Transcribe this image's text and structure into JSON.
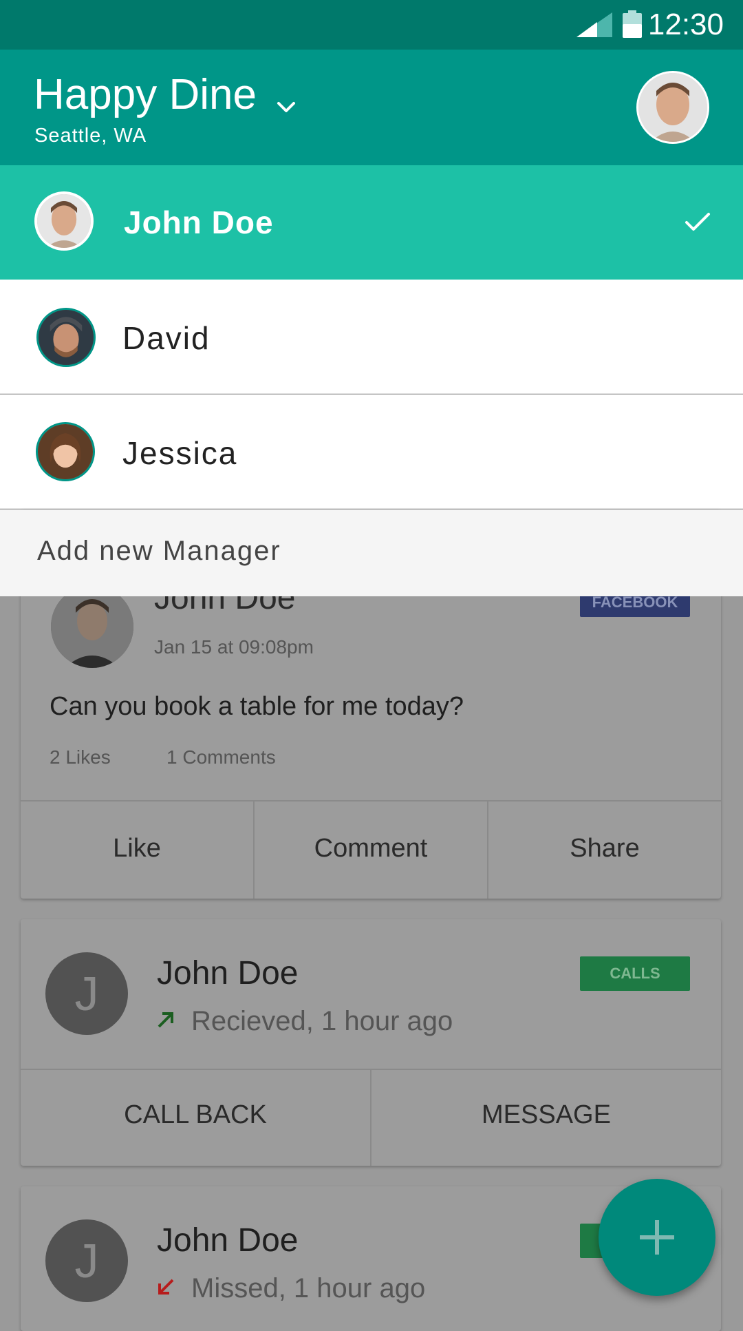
{
  "status_bar": {
    "time": "12:30",
    "icons": [
      "signal-icon",
      "battery-icon"
    ]
  },
  "app_bar": {
    "title": "Happy Dine",
    "subtitle": "Seattle, WA",
    "dropdown_icon": "chevron-down-icon",
    "avatar": "profile-avatar"
  },
  "manager_menu": {
    "selected": {
      "name": "John Doe",
      "icon": "check-icon"
    },
    "items": [
      {
        "name": "David"
      },
      {
        "name": "Jessica"
      }
    ],
    "add_label": "Add new Manager"
  },
  "feed": {
    "post": {
      "author": "John Doe",
      "date": "Jan 15 at 09:08pm",
      "badge": "FACEBOOK",
      "text": "Can you book a table for me today?",
      "likes": "2 Likes",
      "comments": "1 Comments",
      "actions": [
        "Like",
        "Comment",
        "Share"
      ]
    },
    "calls": [
      {
        "initial": "J",
        "name": "John Doe",
        "status": "Recieved, 1 hour ago",
        "badge": "CALLS",
        "icon": "arrow-up-right-icon",
        "actions": [
          "CALL BACK",
          "MESSAGE"
        ]
      },
      {
        "initial": "J",
        "name": "John Doe",
        "status": "Missed, 1 hour ago",
        "icon": "arrow-down-left-icon"
      }
    ]
  },
  "fab": {
    "icon": "plus-icon"
  },
  "colors": {
    "status_bar": "#00796b",
    "app_bar": "#009688",
    "selected_row": "#1dc1a6",
    "calls_badge": "#1e7a44",
    "facebook_badge": "#2e3a6e"
  }
}
